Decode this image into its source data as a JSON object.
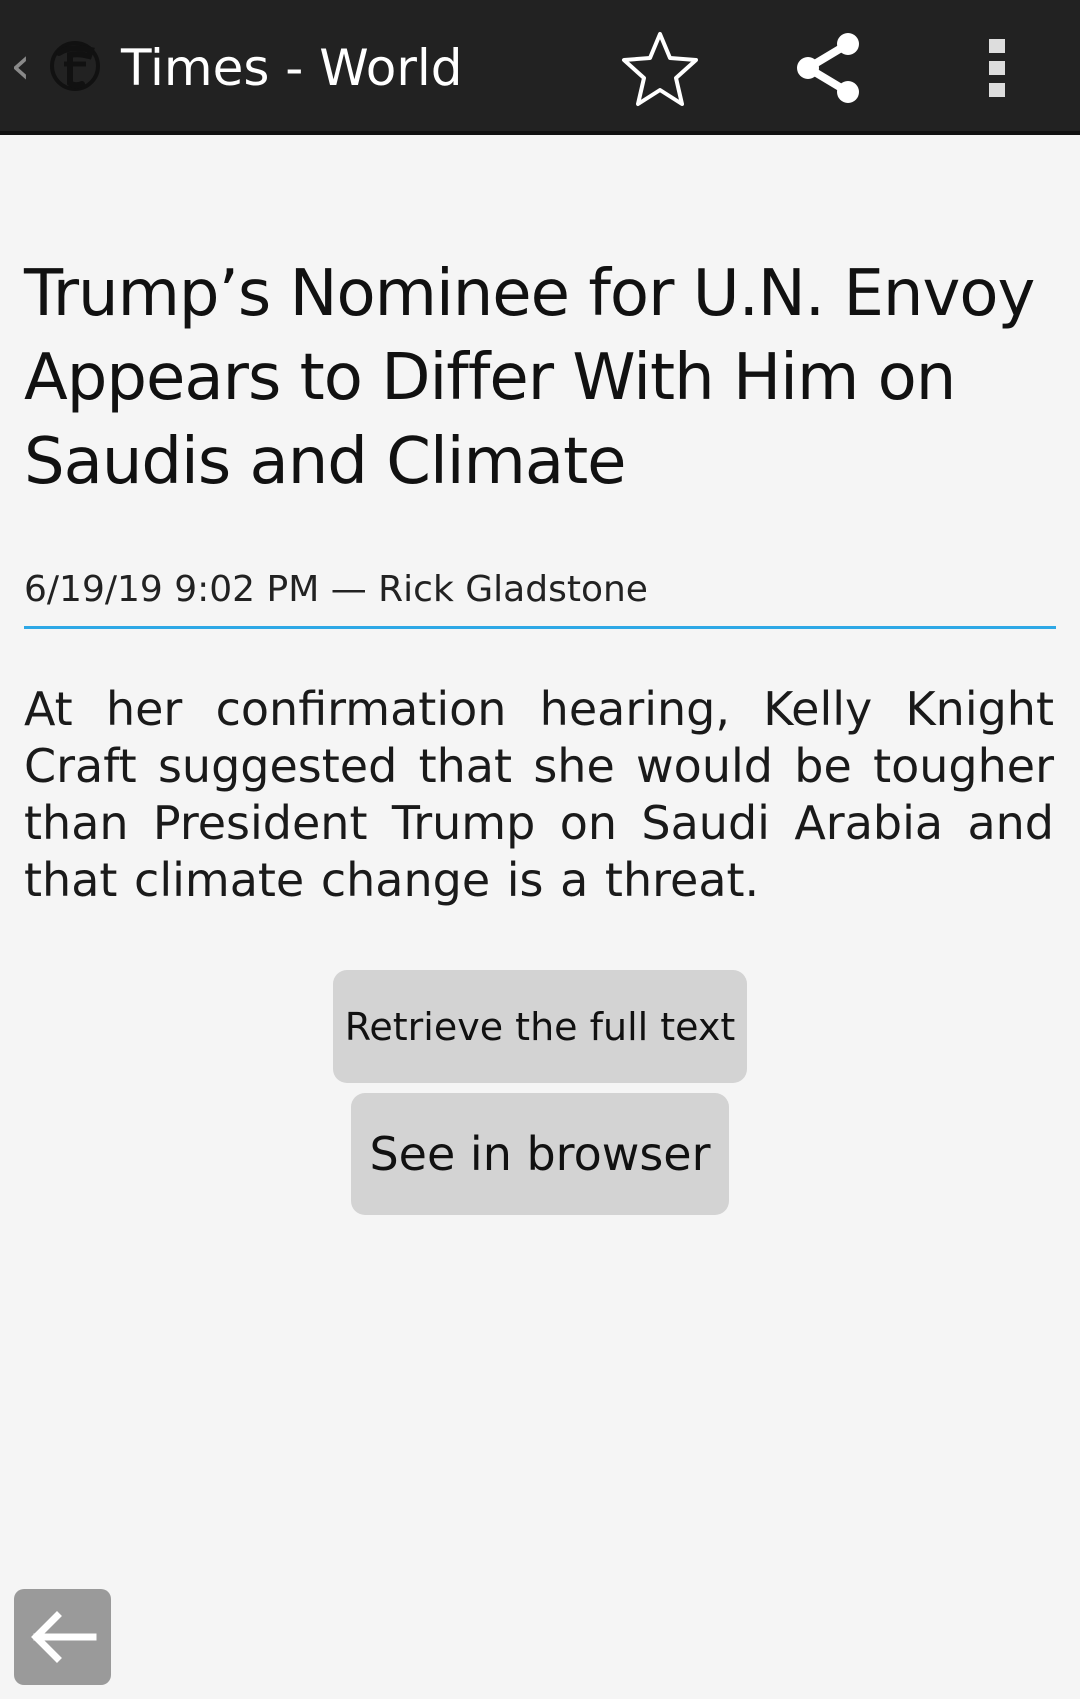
{
  "app_bar": {
    "back_glyph": "‹",
    "logo_icon": "nyt-t-logo-icon",
    "title": "Times - World",
    "actions": [
      {
        "name": "star-icon"
      },
      {
        "name": "share-icon"
      },
      {
        "name": "overflow-menu-icon"
      }
    ],
    "background": "#222222"
  },
  "article": {
    "headline": "Trump’s Nominee for U.N. Envoy Appears to Differ With Him on Saudis and Climate",
    "meta": "6/19/19 9:02 PM — Rick Gladstone",
    "summary": "At her confirmation hearing, Kelly Knight Craft suggested that she would be tougher than President Trump on Saudi Arabia and that climate change is a threat.",
    "divider_color": "#2ea8e6"
  },
  "buttons": {
    "retrieve_full_text": "Retrieve the full text",
    "see_in_browser": "See in browser"
  },
  "floating": {
    "back_icon": "arrow-left-icon"
  }
}
